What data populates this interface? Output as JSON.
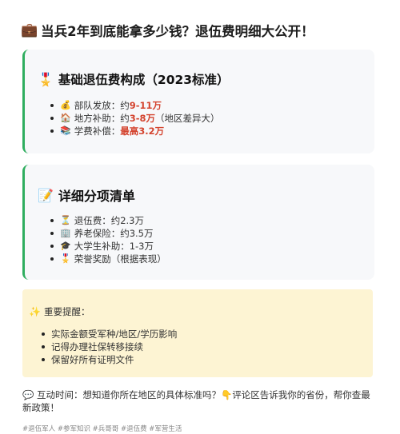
{
  "title": {
    "icon": "briefcase",
    "text": "当兵2年到底能拿多少钱？退伍费明细大公开！"
  },
  "section1": {
    "icon": "medal",
    "heading": "基础退伍费构成（2023标准）",
    "items": [
      {
        "icon": "money-bag",
        "label": "部队发放：约",
        "highlight": "9-11万",
        "suffix": ""
      },
      {
        "icon": "house",
        "label": "地方补助：约",
        "highlight": "3-8万",
        "suffix": "（地区差异大）"
      },
      {
        "icon": "books",
        "label": "学费补偿：",
        "highlight": "最高3.2万",
        "suffix": ""
      }
    ]
  },
  "section2": {
    "icon": "memo",
    "heading": "详细分项清单",
    "items": [
      {
        "icon": "hourglass",
        "label": "退伍费：约2.3万"
      },
      {
        "icon": "building",
        "label": "养老保险：约3.5万"
      },
      {
        "icon": "graduation-cap",
        "label": "大学生补助：1-3万"
      },
      {
        "icon": "medal",
        "label": "荣誉奖励（根据表现）"
      }
    ]
  },
  "notice": {
    "icon": "sparkle",
    "heading": "重要提醒：",
    "items": [
      "实际金额受军种/地区/学历影响",
      "记得办理社保转移接续",
      "保留好所有证明文件"
    ]
  },
  "interaction": {
    "icon": "speech-bubble",
    "text": "互动时间：想知道你所在地区的具体标准吗？",
    "pointer_icon": "pointing-hand",
    "text2": "评论区告诉我你的省份，帮你查最新政策！"
  },
  "tags": "#退伍军人 #参军知识 #兵哥哥 #退伍费 #军营生活",
  "colors": {
    "accent_green": "#2fae5f",
    "highlight_red": "#d4442f",
    "notice_bg": "#fdf4d3",
    "card_bg": "#f7f8fa"
  }
}
